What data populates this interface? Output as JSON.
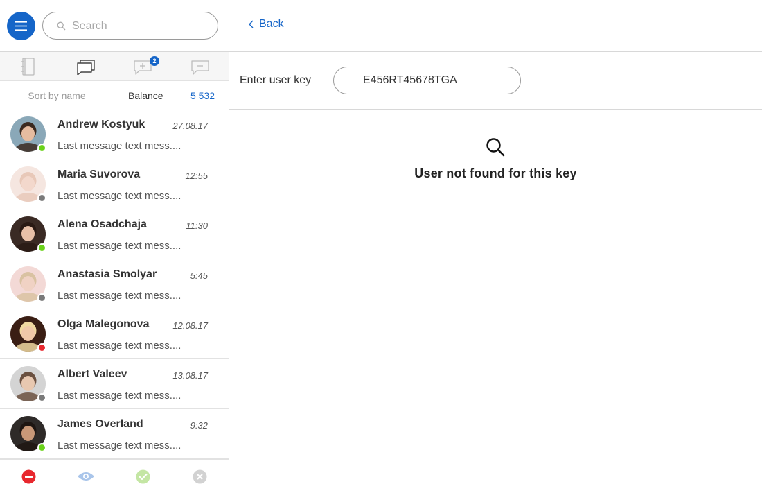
{
  "sidebar": {
    "search": {
      "placeholder": "Search",
      "value": ""
    },
    "tabs": [
      {
        "icon": "contacts-book-icon",
        "badge": ""
      },
      {
        "icon": "chats-icon",
        "badge": ""
      },
      {
        "icon": "add-chat-icon",
        "badge": "2"
      },
      {
        "icon": "remove-chat-icon",
        "badge": ""
      }
    ],
    "sort_label": "Sort by name",
    "balance_label": "Balance",
    "balance_value": "5 532",
    "contacts": [
      {
        "name": "Andrew Kostyuk",
        "time": "27.08.17",
        "message": "Last message text mess....",
        "status": "online",
        "status_color": "#6ad21a",
        "avatar_bg": "#8aa8b8",
        "skin": "#e6bca0",
        "hair": "#3b2a20"
      },
      {
        "name": "Maria Suvorova",
        "time": "12:55",
        "message": "Last message text mess....",
        "status": "offline",
        "status_color": "#7a7a7a",
        "avatar_bg": "#f5e6e0",
        "skin": "#f3d8cc",
        "hair": "#e8c8b8"
      },
      {
        "name": "Alena Osadchaja",
        "time": "11:30",
        "message": "Last message text mess....",
        "status": "online",
        "status_color": "#6ad21a",
        "avatar_bg": "#3a2a24",
        "skin": "#e8c0a8",
        "hair": "#2a1a14"
      },
      {
        "name": "Anastasia Smolyar",
        "time": "5:45",
        "message": "Last message text mess....",
        "status": "offline",
        "status_color": "#7a7a7a",
        "avatar_bg": "#f3d9d6",
        "skin": "#f0d2c4",
        "hair": "#d9c2a2"
      },
      {
        "name": "Olga Malegonova",
        "time": "12.08.17",
        "message": "Last message text mess....",
        "status": "busy",
        "status_color": "#e8282e",
        "avatar_bg": "#3a1e14",
        "skin": "#f0c8a8",
        "hair": "#f0d8a0"
      },
      {
        "name": "Albert Valeev",
        "time": "13.08.17",
        "message": "Last message text mess....",
        "status": "offline",
        "status_color": "#7a7a7a",
        "avatar_bg": "#d4d4d4",
        "skin": "#e8c8b0",
        "hair": "#6a5040"
      },
      {
        "name": "James Overland",
        "time": "9:32",
        "message": "Last message text mess....",
        "status": "online",
        "status_color": "#6ad21a",
        "avatar_bg": "#2e2a28",
        "skin": "#c89878",
        "hair": "#1e1612"
      }
    ],
    "actions": [
      {
        "icon": "block-icon",
        "color": "#e8282e"
      },
      {
        "icon": "eye-icon",
        "color": "#a9c5ea"
      },
      {
        "icon": "check-icon",
        "color": "#c4e6a4"
      },
      {
        "icon": "close-icon",
        "color": "#cfcfcf"
      }
    ]
  },
  "main": {
    "back_label": "Back",
    "key_label": "Enter user key",
    "key_value": "E456RT45678TGA",
    "result_text": "User not found for this key"
  },
  "colors": {
    "accent": "#1565c8",
    "online": "#6ad21a",
    "offline": "#7a7a7a",
    "busy": "#e8282e"
  }
}
